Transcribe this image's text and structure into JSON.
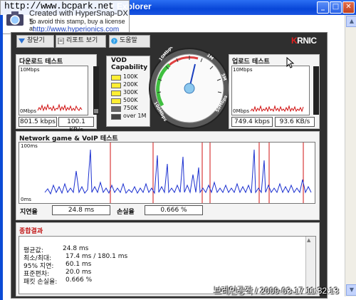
{
  "window": {
    "title": "et Explorer",
    "url_stamp": "http://www.bcpark.net"
  },
  "stamp": {
    "line1": "Created with HyperSnap-DX 5",
    "line2": "To avoid this stamp, buy a license at",
    "line3": "http://www.hyperionics.com"
  },
  "toolbar": {
    "new_window": "창닫기",
    "report": "리포트 보기",
    "help": "도움말"
  },
  "brand": {
    "logo_text": "KRNIC",
    "accent": "#e02020"
  },
  "download": {
    "title": "다운로드 테스트",
    "scale_top": "10Mbps",
    "scale_bottom": "0Mbps",
    "speed_kbps": "801.5 kbps",
    "speed_kBs": "100.1 KB/s"
  },
  "upload": {
    "title": "업로드 테스트",
    "scale_top": "10Mbps",
    "scale_bottom": "0Mbps",
    "speed_kbps": "749.4 kbps",
    "speed_kBs": "93.6 KB/s"
  },
  "vod": {
    "title_line1": "VOD",
    "title_line2": "Capability",
    "levels": [
      {
        "label": "100K",
        "color": "#ffee33"
      },
      {
        "label": "200K",
        "color": "#ffee33"
      },
      {
        "label": "300K",
        "color": "#ffee33"
      },
      {
        "label": "500K",
        "color": "#ffee33"
      },
      {
        "label": "750K",
        "color": "#666666"
      },
      {
        "label": "over 1M",
        "color": "#444444"
      }
    ]
  },
  "gauge": {
    "labels": [
      "10Mbps",
      "1M",
      "5M",
      "50Mbps",
      "100Mbps"
    ]
  },
  "network": {
    "title": "Network game & VoIP 테스트",
    "scale_top": "100ms",
    "scale_bottom": "0ms",
    "latency_label": "지연율",
    "latency_value": "24.8 ms",
    "loss_label": "손실율",
    "loss_value": "0.666 %"
  },
  "summary": {
    "title": "종합결과",
    "rows": [
      {
        "label": "평균값:",
        "value": "24.8 ms"
      },
      {
        "label": "최소/최대:",
        "value": "17.4 ms / 180.1 ms"
      },
      {
        "label": "95% 지연:",
        "value": "60.1 ms"
      },
      {
        "label": "표준편차:",
        "value": "20.0 ms"
      },
      {
        "label": "패킷 손실율:",
        "value": "0.666 %"
      }
    ]
  },
  "footer_stamp": "브레인공작 / 2009-03-17 11:32:13"
}
